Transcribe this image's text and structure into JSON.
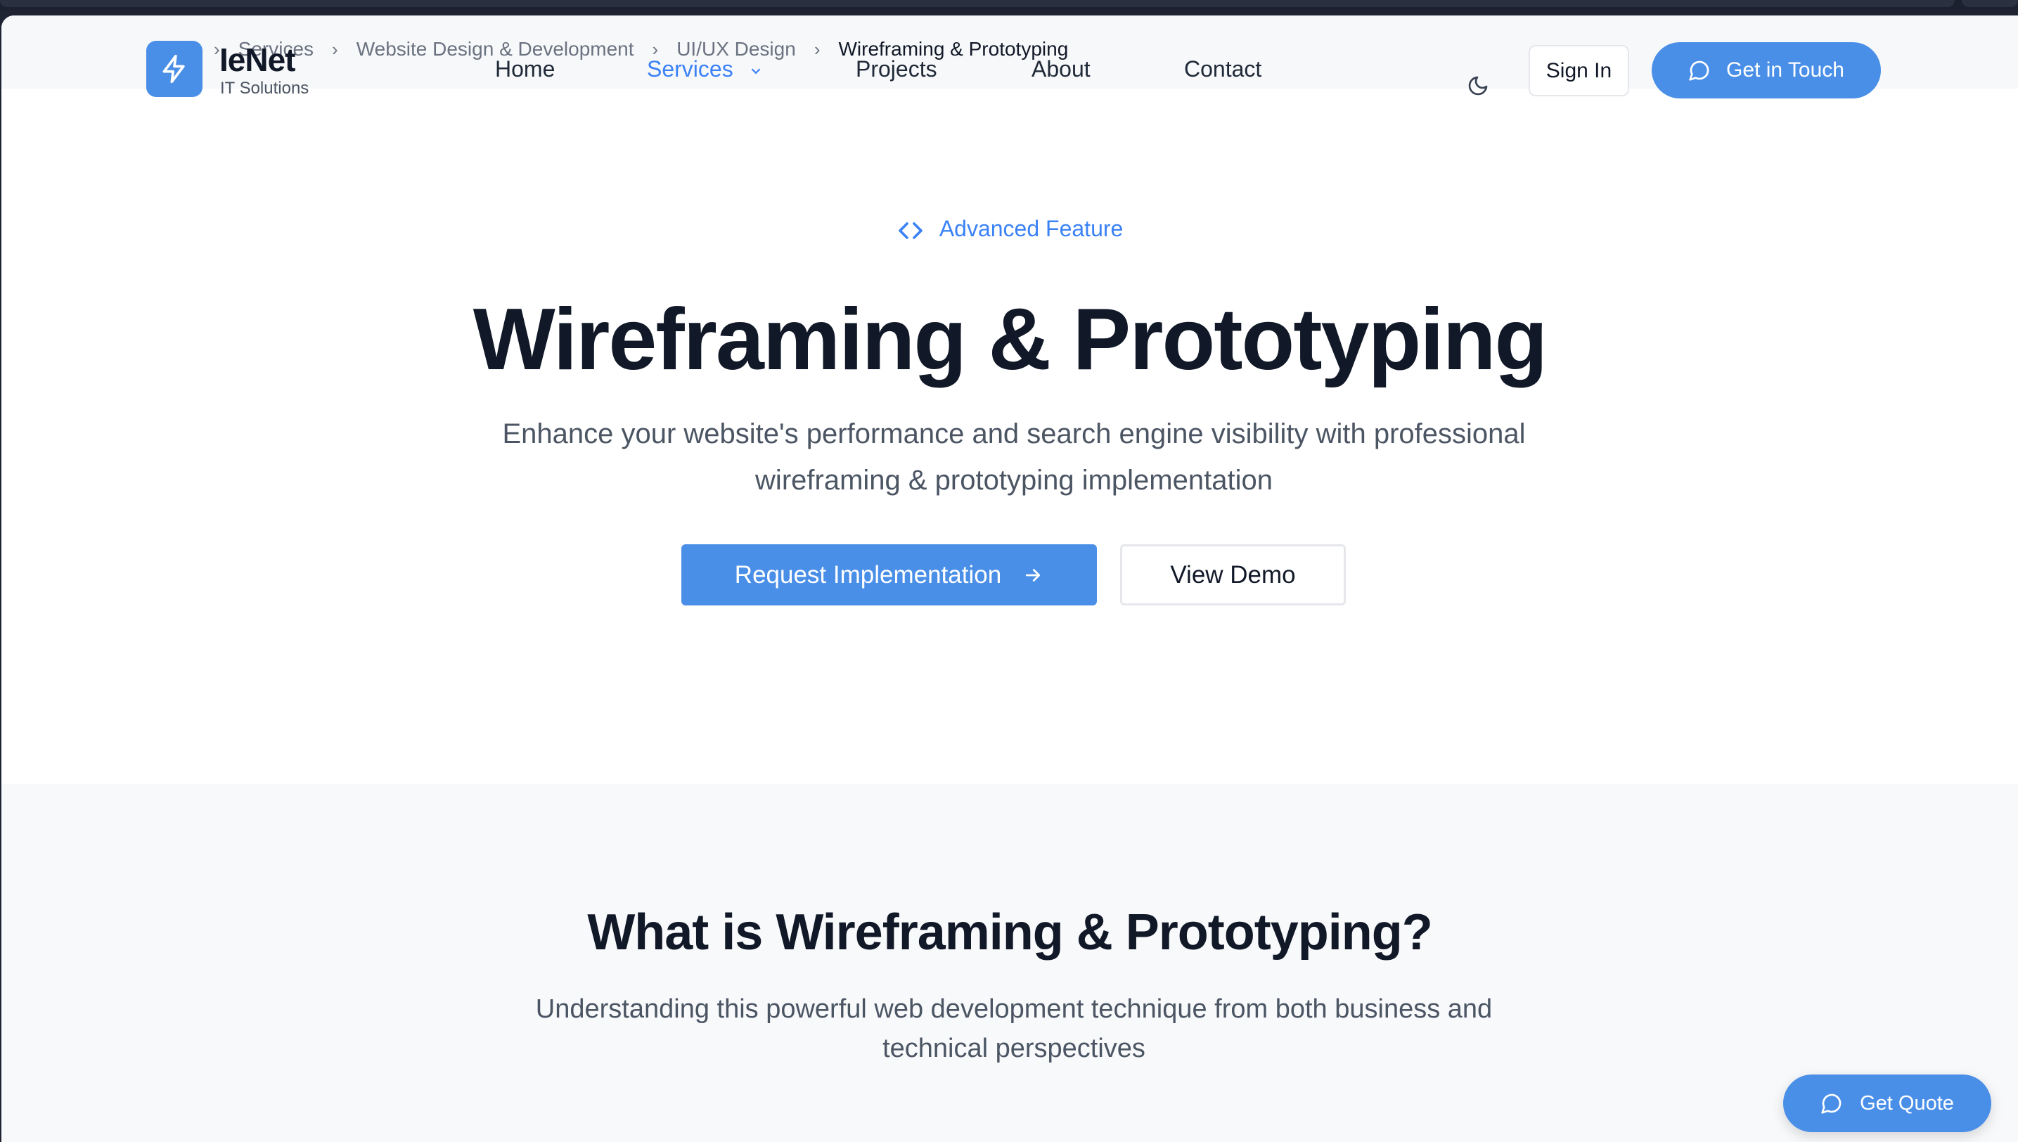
{
  "brand": {
    "name": "IeNet",
    "tagline": "IT Solutions",
    "accent": "#4a8fe7"
  },
  "breadcrumb": {
    "items": [
      "Services",
      "Website Design & Development",
      "UI/UX Design"
    ],
    "current": "Wireframing & Prototyping"
  },
  "nav": {
    "home": "Home",
    "services": "Services",
    "projects": "Projects",
    "about": "About",
    "contact": "Contact"
  },
  "header_actions": {
    "theme_icon": "moon-icon",
    "sign_in": "Sign In",
    "get_in_touch": "Get in Touch"
  },
  "hero": {
    "badge": "Advanced Feature",
    "title": "Wireframing & Prototyping",
    "subtitle": "Enhance your website's performance and search engine visibility with professional wireframing & prototyping implementation",
    "primary_cta": "Request Implementation",
    "secondary_cta": "View Demo"
  },
  "what_is": {
    "title": "What is Wireframing & Prototyping?",
    "subtitle": "Understanding this powerful web development technique from both business and technical perspectives"
  },
  "floating": {
    "get_quote": "Get Quote"
  }
}
